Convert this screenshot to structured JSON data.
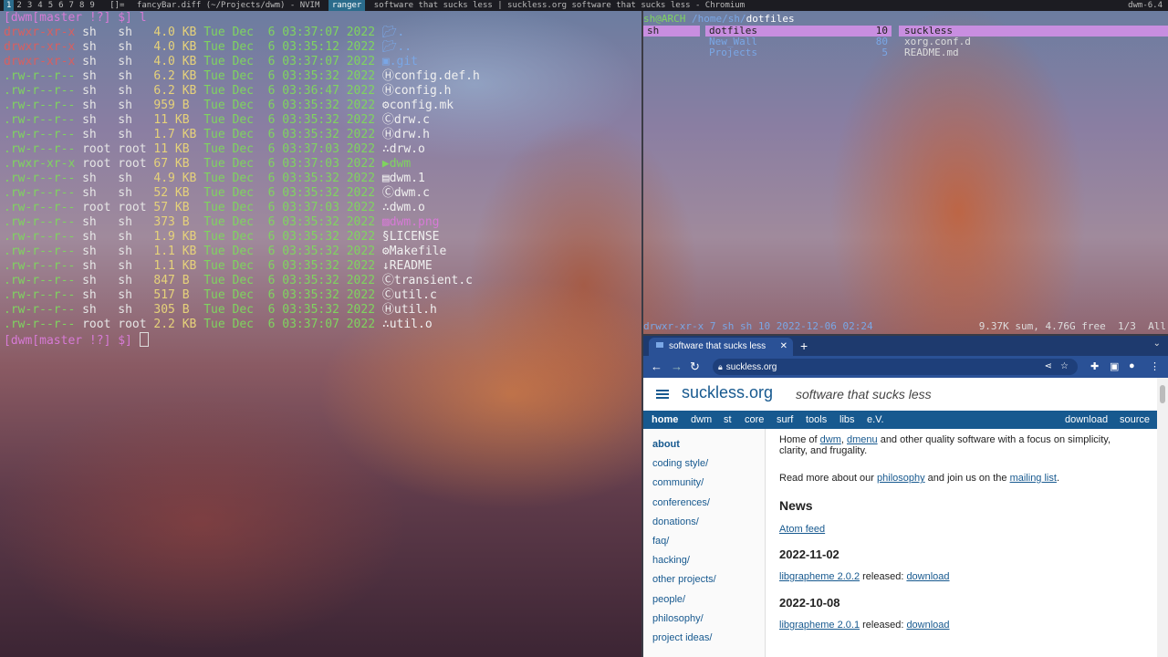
{
  "topbar": {
    "tags": [
      "1",
      "2",
      "3",
      "4",
      "5",
      "6",
      "7",
      "8",
      "9"
    ],
    "layout": "[]=",
    "windows": [
      "fancyBar.diff (~/Projects/dwm) - NVIM",
      "ranger",
      "software that sucks less | suckless.org software that sucks less - Chromium"
    ],
    "status": "dwm-6.4"
  },
  "terminal": {
    "prompt": "[dwm[master !?] $] l",
    "end_prompt": "[dwm[master !?] $] ",
    "entries": [
      {
        "perm": "drwxr-xr-x",
        "user": "sh",
        "group": "sh",
        "size": "4.0 KB",
        "date": "Tue Dec  6 03:37:07 2022",
        "name": "."
      },
      {
        "perm": "drwxr-xr-x",
        "user": "sh",
        "group": "sh",
        "size": "4.0 KB",
        "date": "Tue Dec  6 03:35:12 2022",
        "name": ".."
      },
      {
        "perm": "drwxr-xr-x",
        "user": "sh",
        "group": "sh",
        "size": "4.0 KB",
        "date": "Tue Dec  6 03:37:07 2022",
        "name": ".git"
      },
      {
        "perm": ".rw-r--r--",
        "user": "sh",
        "group": "sh",
        "size": "6.2 KB",
        "date": "Tue Dec  6 03:35:32 2022",
        "name": "config.def.h"
      },
      {
        "perm": ".rw-r--r--",
        "user": "sh",
        "group": "sh",
        "size": "6.2 KB",
        "date": "Tue Dec  6 03:36:47 2022",
        "name": "config.h"
      },
      {
        "perm": ".rw-r--r--",
        "user": "sh",
        "group": "sh",
        "size": "959 B",
        "date": "Tue Dec  6 03:35:32 2022",
        "name": "config.mk"
      },
      {
        "perm": ".rw-r--r--",
        "user": "sh",
        "group": "sh",
        "size": "11 KB",
        "date": "Tue Dec  6 03:35:32 2022",
        "name": "drw.c"
      },
      {
        "perm": ".rw-r--r--",
        "user": "sh",
        "group": "sh",
        "size": "1.7 KB",
        "date": "Tue Dec  6 03:35:32 2022",
        "name": "drw.h"
      },
      {
        "perm": ".rw-r--r--",
        "user": "root",
        "group": "root",
        "size": "11 KB",
        "date": "Tue Dec  6 03:37:03 2022",
        "name": "drw.o"
      },
      {
        "perm": ".rwxr-xr-x",
        "user": "root",
        "group": "root",
        "size": "67 KB",
        "date": "Tue Dec  6 03:37:03 2022",
        "name": "dwm"
      },
      {
        "perm": ".rw-r--r--",
        "user": "sh",
        "group": "sh",
        "size": "4.9 KB",
        "date": "Tue Dec  6 03:35:32 2022",
        "name": "dwm.1"
      },
      {
        "perm": ".rw-r--r--",
        "user": "sh",
        "group": "sh",
        "size": "52 KB",
        "date": "Tue Dec  6 03:35:32 2022",
        "name": "dwm.c"
      },
      {
        "perm": ".rw-r--r--",
        "user": "root",
        "group": "root",
        "size": "57 KB",
        "date": "Tue Dec  6 03:37:03 2022",
        "name": "dwm.o"
      },
      {
        "perm": ".rw-r--r--",
        "user": "sh",
        "group": "sh",
        "size": "373 B",
        "date": "Tue Dec  6 03:35:32 2022",
        "name": "dwm.png"
      },
      {
        "perm": ".rw-r--r--",
        "user": "sh",
        "group": "sh",
        "size": "1.9 KB",
        "date": "Tue Dec  6 03:35:32 2022",
        "name": "LICENSE"
      },
      {
        "perm": ".rw-r--r--",
        "user": "sh",
        "group": "sh",
        "size": "1.1 KB",
        "date": "Tue Dec  6 03:35:32 2022",
        "name": "Makefile"
      },
      {
        "perm": ".rw-r--r--",
        "user": "sh",
        "group": "sh",
        "size": "1.1 KB",
        "date": "Tue Dec  6 03:35:32 2022",
        "name": "README"
      },
      {
        "perm": ".rw-r--r--",
        "user": "sh",
        "group": "sh",
        "size": "847 B",
        "date": "Tue Dec  6 03:35:32 2022",
        "name": "transient.c"
      },
      {
        "perm": ".rw-r--r--",
        "user": "sh",
        "group": "sh",
        "size": "517 B",
        "date": "Tue Dec  6 03:35:32 2022",
        "name": "util.c"
      },
      {
        "perm": ".rw-r--r--",
        "user": "sh",
        "group": "sh",
        "size": "305 B",
        "date": "Tue Dec  6 03:35:32 2022",
        "name": "util.h"
      },
      {
        "perm": ".rw-r--r--",
        "user": "root",
        "group": "root",
        "size": "2.2 KB",
        "date": "Tue Dec  6 03:37:07 2022",
        "name": "util.o"
      }
    ]
  },
  "ranger": {
    "user_host": "sh@ARCH",
    "dir": "/home/sh/",
    "current": "dotfiles",
    "parent": [
      {
        "name": "sh",
        "count": ""
      }
    ],
    "current_col": [
      {
        "name": "dotfiles",
        "count": "10"
      },
      {
        "name": "New_Wall",
        "count": "80"
      },
      {
        "name": "Projects",
        "count": "5"
      }
    ],
    "preview": [
      "suckless",
      "xorg.conf.d",
      "README.md"
    ],
    "status_left": "drwxr-xr-x 7 sh sh 10 2022-12-06 02:24",
    "status_right": "9.37K sum, 4.76G free  1/3  All"
  },
  "browser": {
    "tab_title": "software that sucks less",
    "url": "suckless.org",
    "site": {
      "name": "suckless.org",
      "tagline": "software that sucks less",
      "menu": [
        "home",
        "dwm",
        "st",
        "core",
        "surf",
        "tools",
        "libs",
        "e.V."
      ],
      "menu_right": [
        "download",
        "source"
      ],
      "sidebar": [
        "about",
        "coding style/",
        "community/",
        "conferences/",
        "donations/",
        "faq/",
        "hacking/",
        "other projects/",
        "people/",
        "philosophy/",
        "project ideas/"
      ],
      "intro_a": "Home of ",
      "intro_dwm": "dwm",
      "intro_sep": ", ",
      "intro_dmenu": "dmenu",
      "intro_b": " and other quality software with a focus on simplicity, clarity, and frugality.",
      "read_a": "Read more about our ",
      "read_philosophy": "philosophy",
      "read_b": " and join us on the ",
      "read_mailing": "mailing list",
      "read_c": ".",
      "news_title": "News",
      "atom": "Atom feed",
      "news": [
        {
          "date": "2022-11-02",
          "pkg": "libgrapheme 2.0.2",
          "text": " released: ",
          "link": "download"
        },
        {
          "date": "2022-10-08",
          "pkg": "libgrapheme 2.0.1",
          "text": " released: ",
          "link": "download"
        }
      ]
    }
  },
  "colors": {
    "accent": "#17598f",
    "chrome_tabs": "#1e3a6e",
    "ranger_sel": "#c88ee0"
  }
}
